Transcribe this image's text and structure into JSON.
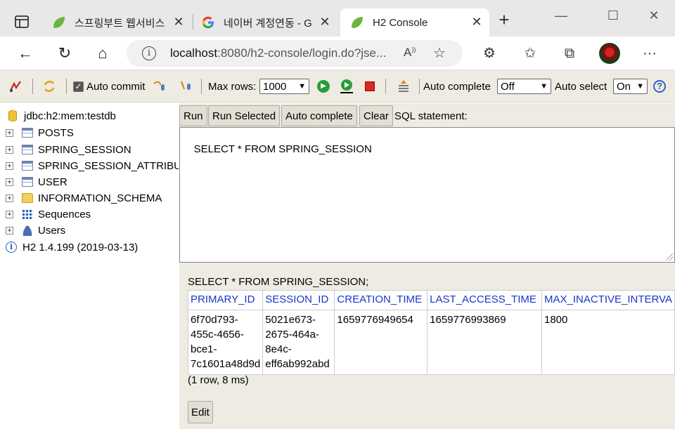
{
  "browser": {
    "tabs": [
      {
        "title": "스프링부트 웹서비스",
        "icon": "spring-leaf-icon"
      },
      {
        "title": "네이버 계정연동 - G",
        "icon": "google-icon"
      },
      {
        "title": "H2 Console",
        "icon": "spring-leaf-icon",
        "active": true
      }
    ],
    "url_host": "localhost",
    "url_path": ":8080/h2-console/login.do?jse..."
  },
  "toolbar": {
    "auto_commit_label": "Auto commit",
    "max_rows_label": "Max rows:",
    "max_rows_value": "1000",
    "auto_complete_label": "Auto complete",
    "auto_complete_value": "Off",
    "auto_select_label": "Auto select",
    "auto_select_value": "On"
  },
  "tree": {
    "connection": "jdbc:h2:mem:testdb",
    "items": [
      {
        "label": "POSTS",
        "icon": "table-icon"
      },
      {
        "label": "SPRING_SESSION",
        "icon": "table-icon"
      },
      {
        "label": "SPRING_SESSION_ATTRIBU",
        "icon": "table-icon"
      },
      {
        "label": "USER",
        "icon": "table-icon"
      },
      {
        "label": "INFORMATION_SCHEMA",
        "icon": "folder-icon"
      },
      {
        "label": "Sequences",
        "icon": "sequences-icon"
      },
      {
        "label": "Users",
        "icon": "users-icon"
      }
    ],
    "version": "H2 1.4.199 (2019-03-13)"
  },
  "query": {
    "run_label": "Run",
    "run_selected_label": "Run Selected",
    "auto_complete_label": "Auto complete",
    "clear_label": "Clear",
    "sql_statement_label": "SQL statement:",
    "sql": "SELECT * FROM SPRING_SESSION"
  },
  "result": {
    "sql": "SELECT * FROM SPRING_SESSION;",
    "columns": [
      "PRIMARY_ID",
      "SESSION_ID",
      "CREATION_TIME",
      "LAST_ACCESS_TIME",
      "MAX_INACTIVE_INTERVA"
    ],
    "row": [
      "6f70d793-\n455c-4656-\nbce1-\n7c1601a48d9d",
      "5021e673-\n2675-464a-\n8e4c-\neff6ab992abd",
      "1659776949654",
      "1659776993869",
      "1800"
    ],
    "status": "(1 row, 8 ms)",
    "edit_label": "Edit"
  }
}
